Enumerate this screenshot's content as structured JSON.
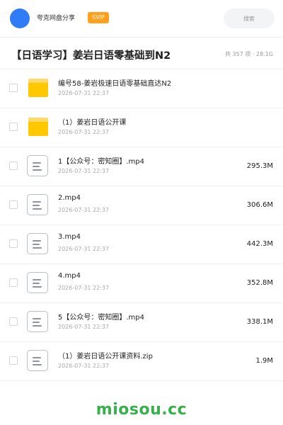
{
  "header": {
    "user_name": "夸克网盘分享",
    "vip_label": "SVIP",
    "search_placeholder": "搜索"
  },
  "folder": {
    "title": "【日语学习】姜岩日语零基础到N2",
    "meta": "共 357 项 · 28.1G"
  },
  "files": [
    {
      "type": "folder",
      "name": "编号58-姜岩极速日语零基础直达N2",
      "date": "2026-07-31 22:37",
      "size": ""
    },
    {
      "type": "folder",
      "name": "（1）姜岩日语公开课",
      "date": "2026-07-31 22:37",
      "size": ""
    },
    {
      "type": "file",
      "name": "1【公众号：密知圈】.mp4",
      "date": "2026-07-31 22:37",
      "size": "295.3M"
    },
    {
      "type": "file",
      "name": "2.mp4",
      "date": "2026-07-31 22:37",
      "size": "306.6M"
    },
    {
      "type": "file",
      "name": "3.mp4",
      "date": "2026-07-31 22:37",
      "size": "442.3M"
    },
    {
      "type": "file",
      "name": "4.mp4",
      "date": "2026-07-31 22:37",
      "size": "352.8M"
    },
    {
      "type": "file",
      "name": "5【公众号：密知圈】.mp4",
      "date": "2026-07-31 22:37",
      "size": "338.1M"
    },
    {
      "type": "file",
      "name": "（1）姜岩日语公开课资料.zip",
      "date": "2026-07-31 22:37",
      "size": "1.9M"
    }
  ],
  "watermark": "miosou.cc",
  "icons": {
    "folder": "folder-icon",
    "file": "document-icon",
    "avatar": "avatar"
  },
  "colors": {
    "accent": "#2f7cf6",
    "vip": "#ff9f1c",
    "folder": "#ffc800",
    "watermark": "#35b04a"
  }
}
